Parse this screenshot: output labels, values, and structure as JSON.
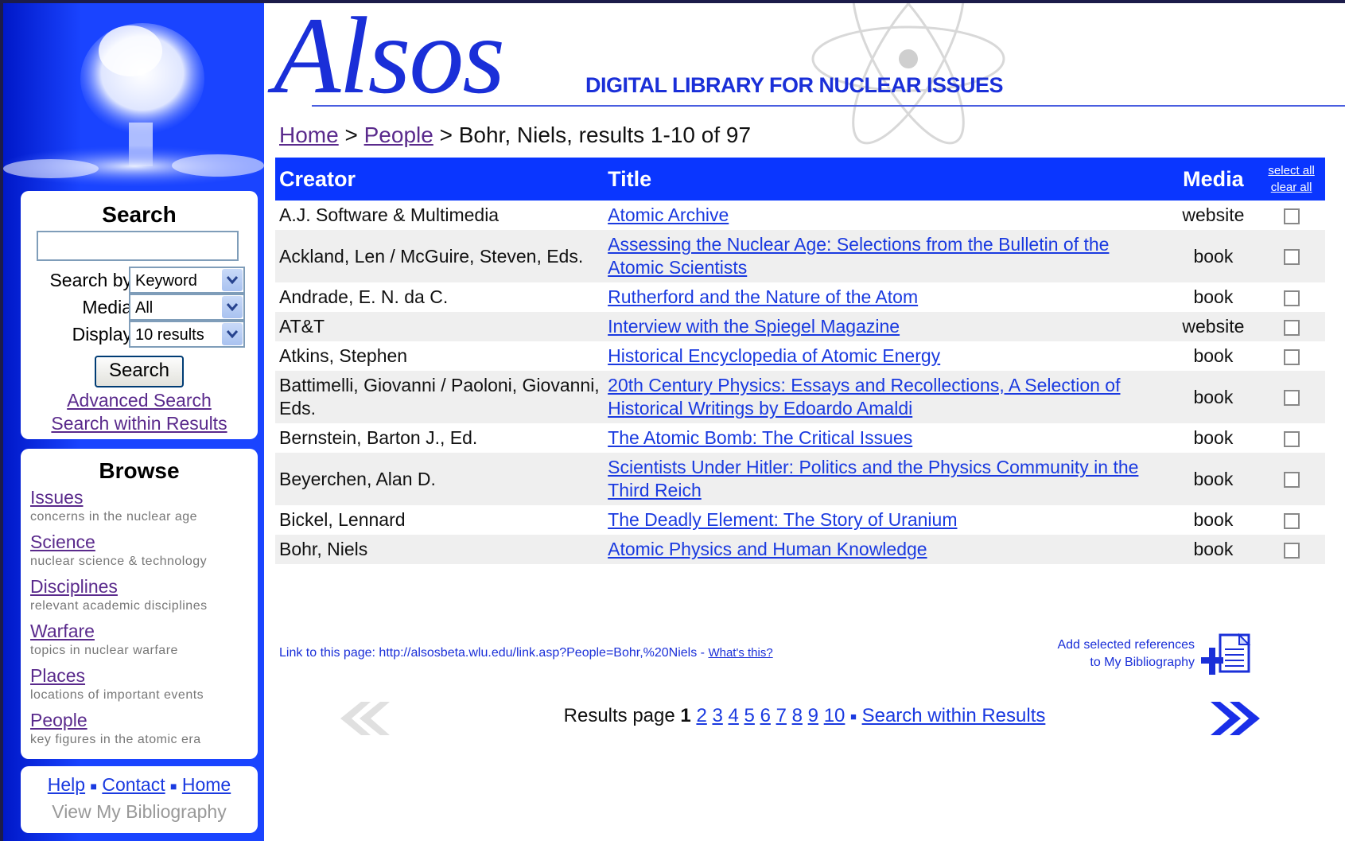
{
  "colors": {
    "primary": "#0a36ff",
    "link": "#1a3ae0",
    "visited": "#5a2a8c"
  },
  "sidebar": {
    "search": {
      "heading": "Search",
      "search_by_label": "Search by",
      "search_by_value": "Keyword",
      "media_label": "Media",
      "media_value": "All",
      "display_label": "Display",
      "display_value": "10 results",
      "button": "Search",
      "advanced": "Advanced Search",
      "within": "Search within Results"
    },
    "browse": {
      "heading": "Browse",
      "items": [
        {
          "label": "Issues",
          "desc": "concerns in the nuclear age"
        },
        {
          "label": "Science",
          "desc": "nuclear science & technology"
        },
        {
          "label": "Disciplines",
          "desc": "relevant academic disciplines"
        },
        {
          "label": "Warfare",
          "desc": "topics in nuclear warfare"
        },
        {
          "label": "Places",
          "desc": "locations of important events"
        },
        {
          "label": "People",
          "desc": "key figures in the atomic era"
        }
      ]
    },
    "footer": {
      "help": "Help",
      "contact": "Contact",
      "home": "Home",
      "bibliography": "View My Bibliography"
    }
  },
  "header": {
    "logo": "Alsos",
    "tagline": "DIGITAL LIBRARY FOR NUCLEAR ISSUES"
  },
  "breadcrumb": {
    "home": "Home",
    "sep": ">",
    "people": "People",
    "current": "> Bohr, Niels, results 1-10 of 97"
  },
  "table": {
    "columns": {
      "creator": "Creator",
      "title": "Title",
      "media": "Media",
      "select_all": "select all",
      "clear_all": "clear all"
    },
    "rows": [
      {
        "creator": "A.J. Software & Multimedia",
        "title": "Atomic Archive",
        "media": "website"
      },
      {
        "creator": "Ackland, Len / McGuire, Steven, Eds.",
        "title": "Assessing the Nuclear Age: Selections from the Bulletin of the Atomic Scientists",
        "media": "book"
      },
      {
        "creator": "Andrade, E. N. da C.",
        "title": "Rutherford and the Nature of the Atom",
        "media": "book"
      },
      {
        "creator": "AT&T",
        "title": "Interview with the Spiegel Magazine",
        "media": "website"
      },
      {
        "creator": "Atkins, Stephen",
        "title": "Historical Encyclopedia of Atomic Energy",
        "media": "book"
      },
      {
        "creator": "Battimelli, Giovanni / Paoloni, Giovanni, Eds.",
        "title": "20th Century Physics: Essays and Recollections, A Selection of Historical Writings by Edoardo Amaldi",
        "media": "book"
      },
      {
        "creator": "Bernstein, Barton J., Ed.",
        "title": "The Atomic Bomb: The Critical Issues",
        "media": "book"
      },
      {
        "creator": "Beyerchen, Alan D.",
        "title": "Scientists Under Hitler: Politics and the Physics Community in the Third Reich",
        "media": "book"
      },
      {
        "creator": "Bickel, Lennard",
        "title": "The Deadly Element: The Story of Uranium",
        "media": "book"
      },
      {
        "creator": "Bohr, Niels",
        "title": "Atomic Physics and Human Knowledge",
        "media": "book"
      }
    ]
  },
  "link_line": {
    "text": "Link to this page: http://alsosbeta.wlu.edu/link.asp?People=Bohr,%20Niels - ",
    "whats_this": "What's this?"
  },
  "add_bib": {
    "line1": "Add selected references",
    "line2": "to My Bibliography"
  },
  "pager": {
    "label": "Results page",
    "current": "1",
    "pages": [
      "2",
      "3",
      "4",
      "5",
      "6",
      "7",
      "8",
      "9",
      "10"
    ],
    "within": "Search within Results"
  }
}
